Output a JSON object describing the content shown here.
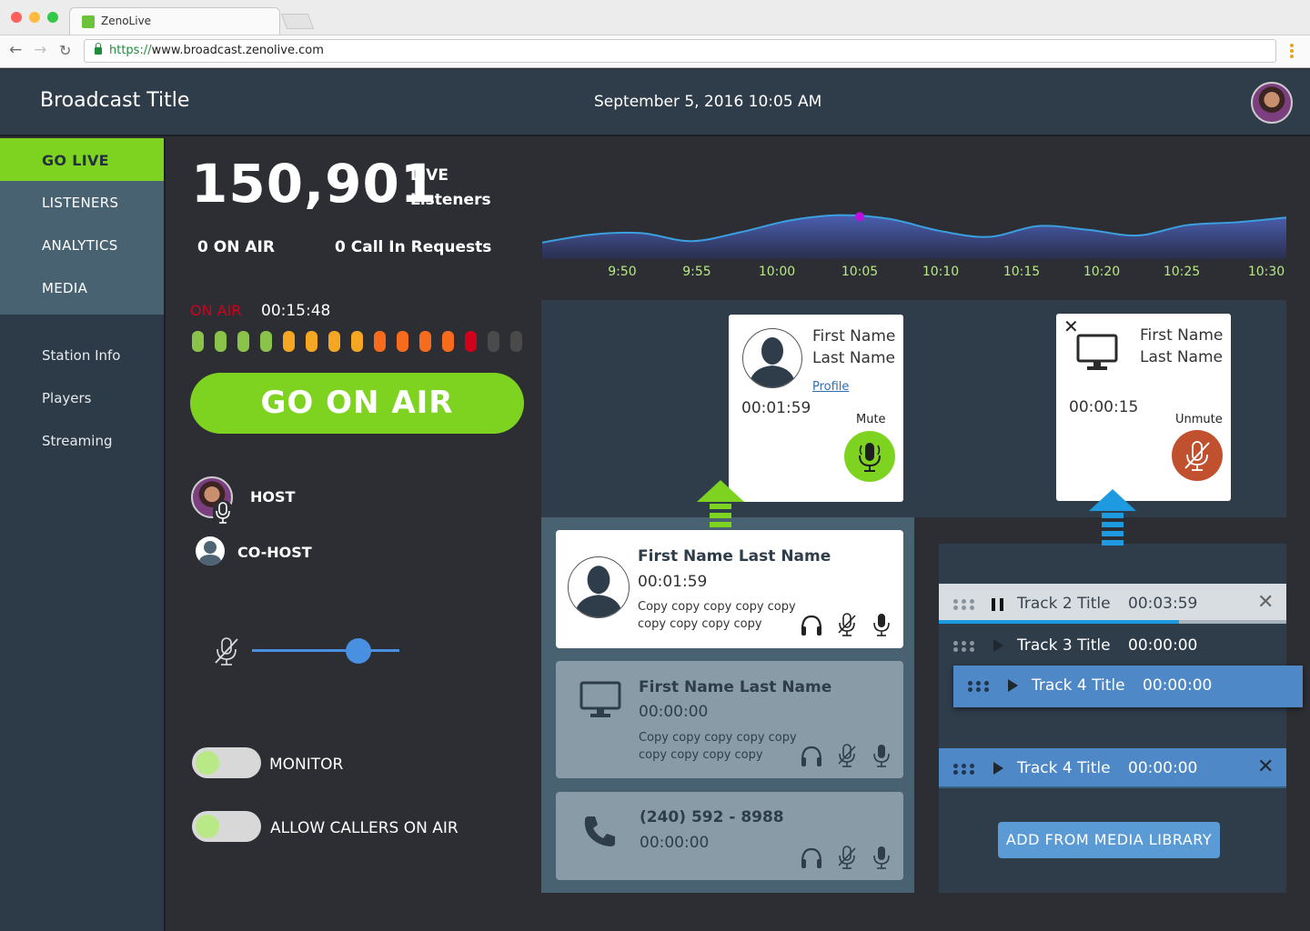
{
  "browser": {
    "tab_title": "ZenoLive",
    "url_scheme": "https://",
    "url_host": "www.broadcast.zenolive.com"
  },
  "header": {
    "title": "Broadcast Title",
    "datetime": "September 5, 2016 10:05 AM"
  },
  "sidebar": {
    "primary": [
      {
        "label": "GO LIVE",
        "active": true
      },
      {
        "label": "LISTENERS",
        "active": false
      },
      {
        "label": "ANALYTICS",
        "active": false
      },
      {
        "label": "MEDIA",
        "active": false
      }
    ],
    "secondary": [
      {
        "label": "Station Info"
      },
      {
        "label": "Players"
      },
      {
        "label": "Streaming"
      }
    ]
  },
  "stats": {
    "listeners": "150,901",
    "listeners_label_1": "LIVE",
    "listeners_label_2": "Listeners",
    "on_air": "0 ON AIR",
    "call_in": "0 Call In Requests"
  },
  "chart_data": {
    "type": "area",
    "x": [
      "9:50",
      "9:55",
      "10:00",
      "10:05",
      "10:10",
      "10:15",
      "10:20",
      "10:25",
      "10:30"
    ],
    "series": [
      {
        "values": [
          0.35,
          0.52,
          0.55,
          0.38,
          0.57,
          0.82,
          0.93,
          0.85,
          0.6,
          0.47,
          0.7,
          0.62,
          0.5,
          0.72,
          0.78,
          0.88
        ]
      }
    ],
    "highlight_label": "10:05",
    "accent_color": "#bd10e0"
  },
  "onair": {
    "label": "ON AIR",
    "timer": "00:15:48",
    "meter": [
      "#8bc34a",
      "#8bc34a",
      "#8bc34a",
      "#8bc34a",
      "#f5a623",
      "#f5a623",
      "#f5a623",
      "#f5a623",
      "#f76b1c",
      "#f76b1c",
      "#f76b1c",
      "#f76b1c",
      "#d0021b",
      "#4a4a4a",
      "#4a4a4a"
    ],
    "button_label": "GO ON AIR"
  },
  "hosts": {
    "host_label": "HOST",
    "cohost_label": "CO-HOST"
  },
  "volume": {
    "level": 0.72
  },
  "toggles": {
    "monitor": "MONITOR",
    "allow_callers": "ALLOW CALLERS ON AIR"
  },
  "stage": {
    "caller_1": {
      "first": "First Name",
      "last": "Last Name",
      "profile_link": "Profile",
      "time": "00:01:59",
      "action": "Mute",
      "action_color": "#7ed321"
    },
    "caller_2": {
      "first": "First Name",
      "last": "Last Name",
      "time": "00:00:15",
      "action": "Unmute",
      "action_color": "#c1502e"
    }
  },
  "queue": [
    {
      "name": "First Name Last Name",
      "time": "00:01:59",
      "copy": "Copy copy copy copy copy copy copy copy copy",
      "type": "person"
    },
    {
      "name": "First Name Last Name",
      "time": "00:00:00",
      "copy": "Copy copy copy copy copy copy copy copy copy",
      "type": "computer"
    },
    {
      "name": "(240) 592 - 8988",
      "time": "00:00:00",
      "type": "phone"
    }
  ],
  "playlist": {
    "tracks": [
      {
        "title": "Track 2 Title",
        "duration": "00:03:59",
        "state": "playing",
        "progress": 0.69
      },
      {
        "title": "Track 3 Title",
        "duration": "00:00:00",
        "state": "idle"
      },
      {
        "title": "Track 4 Title",
        "duration": "00:00:00",
        "state": "dragging"
      },
      {
        "title": "Track 4 Title",
        "duration": "00:00:00",
        "state": "selected"
      }
    ],
    "add_button": "ADD FROM MEDIA LIBRARY"
  }
}
